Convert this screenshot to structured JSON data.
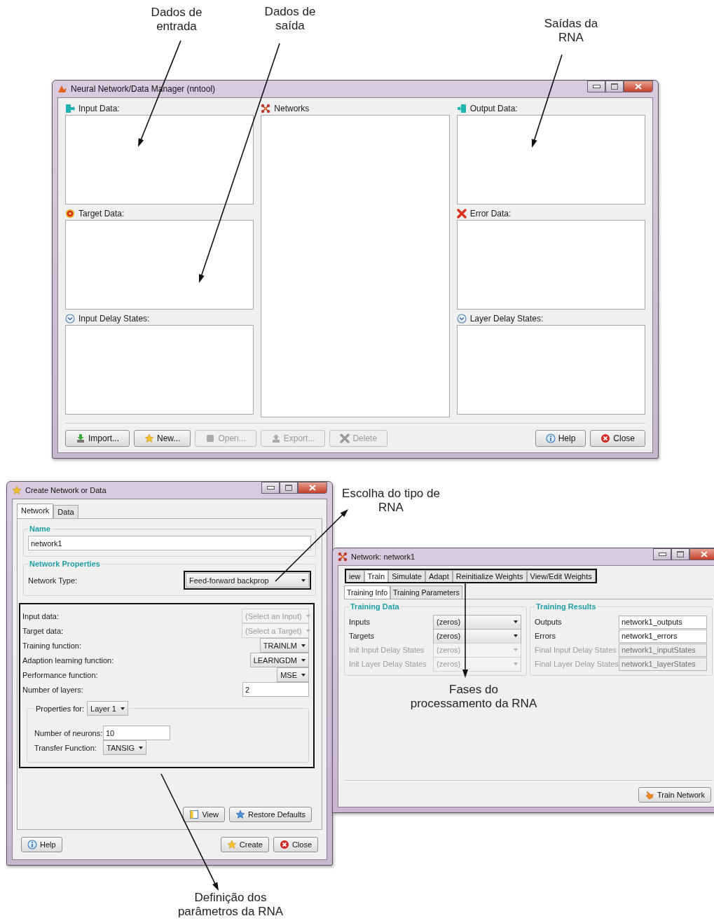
{
  "annotations": [
    {
      "text": "Dados de\nentrada"
    },
    {
      "text": "Dados de\nsaída"
    },
    {
      "text": "Saídas da\nRNA"
    },
    {
      "text": "Escolha do tipo de\nRNA"
    },
    {
      "text": "Fases do\nprocessamento da RNA"
    },
    {
      "text": "Definição dos\nparâmetros da RNA"
    }
  ],
  "manager_window": {
    "title": "Neural Network/Data Manager (nntool)",
    "columns": [
      [
        {
          "label": "Input Data:",
          "kind": "input"
        },
        {
          "label": "Target Data:",
          "kind": "target"
        },
        {
          "label": "Input Delay States:",
          "kind": "delay"
        }
      ],
      [
        {
          "label": "Networks",
          "kind": "network"
        }
      ],
      [
        {
          "label": "Output Data:",
          "kind": "output"
        },
        {
          "label": "Error Data:",
          "kind": "error"
        },
        {
          "label": "Layer Delay States:",
          "kind": "delay"
        }
      ]
    ],
    "left_buttons": [
      {
        "label": "Import...",
        "kind": "import",
        "disabled": false
      },
      {
        "label": "New...",
        "kind": "new",
        "disabled": false
      },
      {
        "label": "Open...",
        "kind": "open",
        "disabled": true
      },
      {
        "label": "Export...",
        "kind": "export",
        "disabled": true
      },
      {
        "label": "Delete",
        "kind": "delete",
        "disabled": true
      }
    ],
    "right_buttons": [
      {
        "label": "Help",
        "kind": "help",
        "disabled": false
      },
      {
        "label": "Close",
        "kind": "close",
        "disabled": false
      }
    ]
  },
  "create_dialog": {
    "title": "Create Network or Data",
    "tabs": [
      {
        "label": "Network",
        "selected": true
      },
      {
        "label": "Data",
        "selected": false
      }
    ],
    "name_group": {
      "legend": "Name",
      "value": "network1"
    },
    "properties_group": {
      "legend": "Network Properties",
      "type_label": "Network Type:",
      "type_value": "Feed-forward backprop",
      "rows": [
        {
          "label": "Input data:",
          "kind": "select",
          "value": "(Select an Input)",
          "disabled": true
        },
        {
          "label": "Target data:",
          "kind": "select",
          "value": "(Select a Target)",
          "disabled": true
        },
        {
          "label": "Training function:",
          "kind": "select",
          "value": "TRAINLM",
          "disabled": false
        },
        {
          "label": "Adaption learning function:",
          "kind": "select",
          "value": "LEARNGDM",
          "disabled": false
        },
        {
          "label": "Performance function:",
          "kind": "select",
          "value": "MSE",
          "disabled": false
        },
        {
          "label": "Number of layers:",
          "kind": "field",
          "value": "2",
          "disabled": false
        }
      ],
      "layer_group": {
        "label": "Properties for:",
        "value": "Layer 1",
        "rows": [
          {
            "label": "Number of neurons:",
            "kind": "field",
            "value": "10",
            "disabled": false
          },
          {
            "label": "Transfer Function:",
            "kind": "select",
            "value": "TANSIG",
            "disabled": false
          }
        ]
      }
    },
    "group_buttons": [
      {
        "label": "View",
        "kind": "view",
        "disabled": false
      },
      {
        "label": "Restore Defaults",
        "kind": "restore",
        "disabled": false
      }
    ],
    "left_buttons": [
      {
        "label": "Help",
        "kind": "help",
        "disabled": false
      }
    ],
    "right_buttons": [
      {
        "label": "Create",
        "kind": "create",
        "disabled": false
      },
      {
        "label": "Close",
        "kind": "close",
        "disabled": false
      }
    ]
  },
  "network_window": {
    "title": "Network: network1",
    "tabs": [
      {
        "label": "iew",
        "selected": false
      },
      {
        "label": "Train",
        "selected": true
      },
      {
        "label": "Simulate",
        "selected": false
      },
      {
        "label": "Adapt",
        "selected": false
      },
      {
        "label": "Reinitialize Weights",
        "selected": false
      },
      {
        "label": "View/Edit Weights",
        "selected": false
      }
    ],
    "subtabs": [
      {
        "label": "Training Info",
        "selected": true
      },
      {
        "label": "Training Parameters",
        "selected": false
      }
    ],
    "training_data": {
      "legend": "Training Data",
      "rows": [
        {
          "label": "Inputs",
          "value": "(zeros)",
          "disabled": false
        },
        {
          "label": "Targets",
          "value": "(zeros)",
          "disabled": false
        },
        {
          "label": "Init Input Delay States",
          "value": "(zeros)",
          "disabled": true
        },
        {
          "label": "Init Layer Delay States",
          "value": "(zeros)",
          "disabled": true
        }
      ]
    },
    "training_results": {
      "legend": "Training Results",
      "rows": [
        {
          "label": "Outputs",
          "value": "network1_outputs",
          "disabled": false
        },
        {
          "label": "Errors",
          "value": "network1_errors",
          "disabled": false
        },
        {
          "label": "Final Input Delay States",
          "value": "network1_inputStates",
          "disabled": true
        },
        {
          "label": "Final Layer Delay States",
          "value": "network1_layerStates",
          "disabled": true
        }
      ]
    },
    "button": {
      "label": "Train Network",
      "kind": "train",
      "disabled": false
    }
  }
}
